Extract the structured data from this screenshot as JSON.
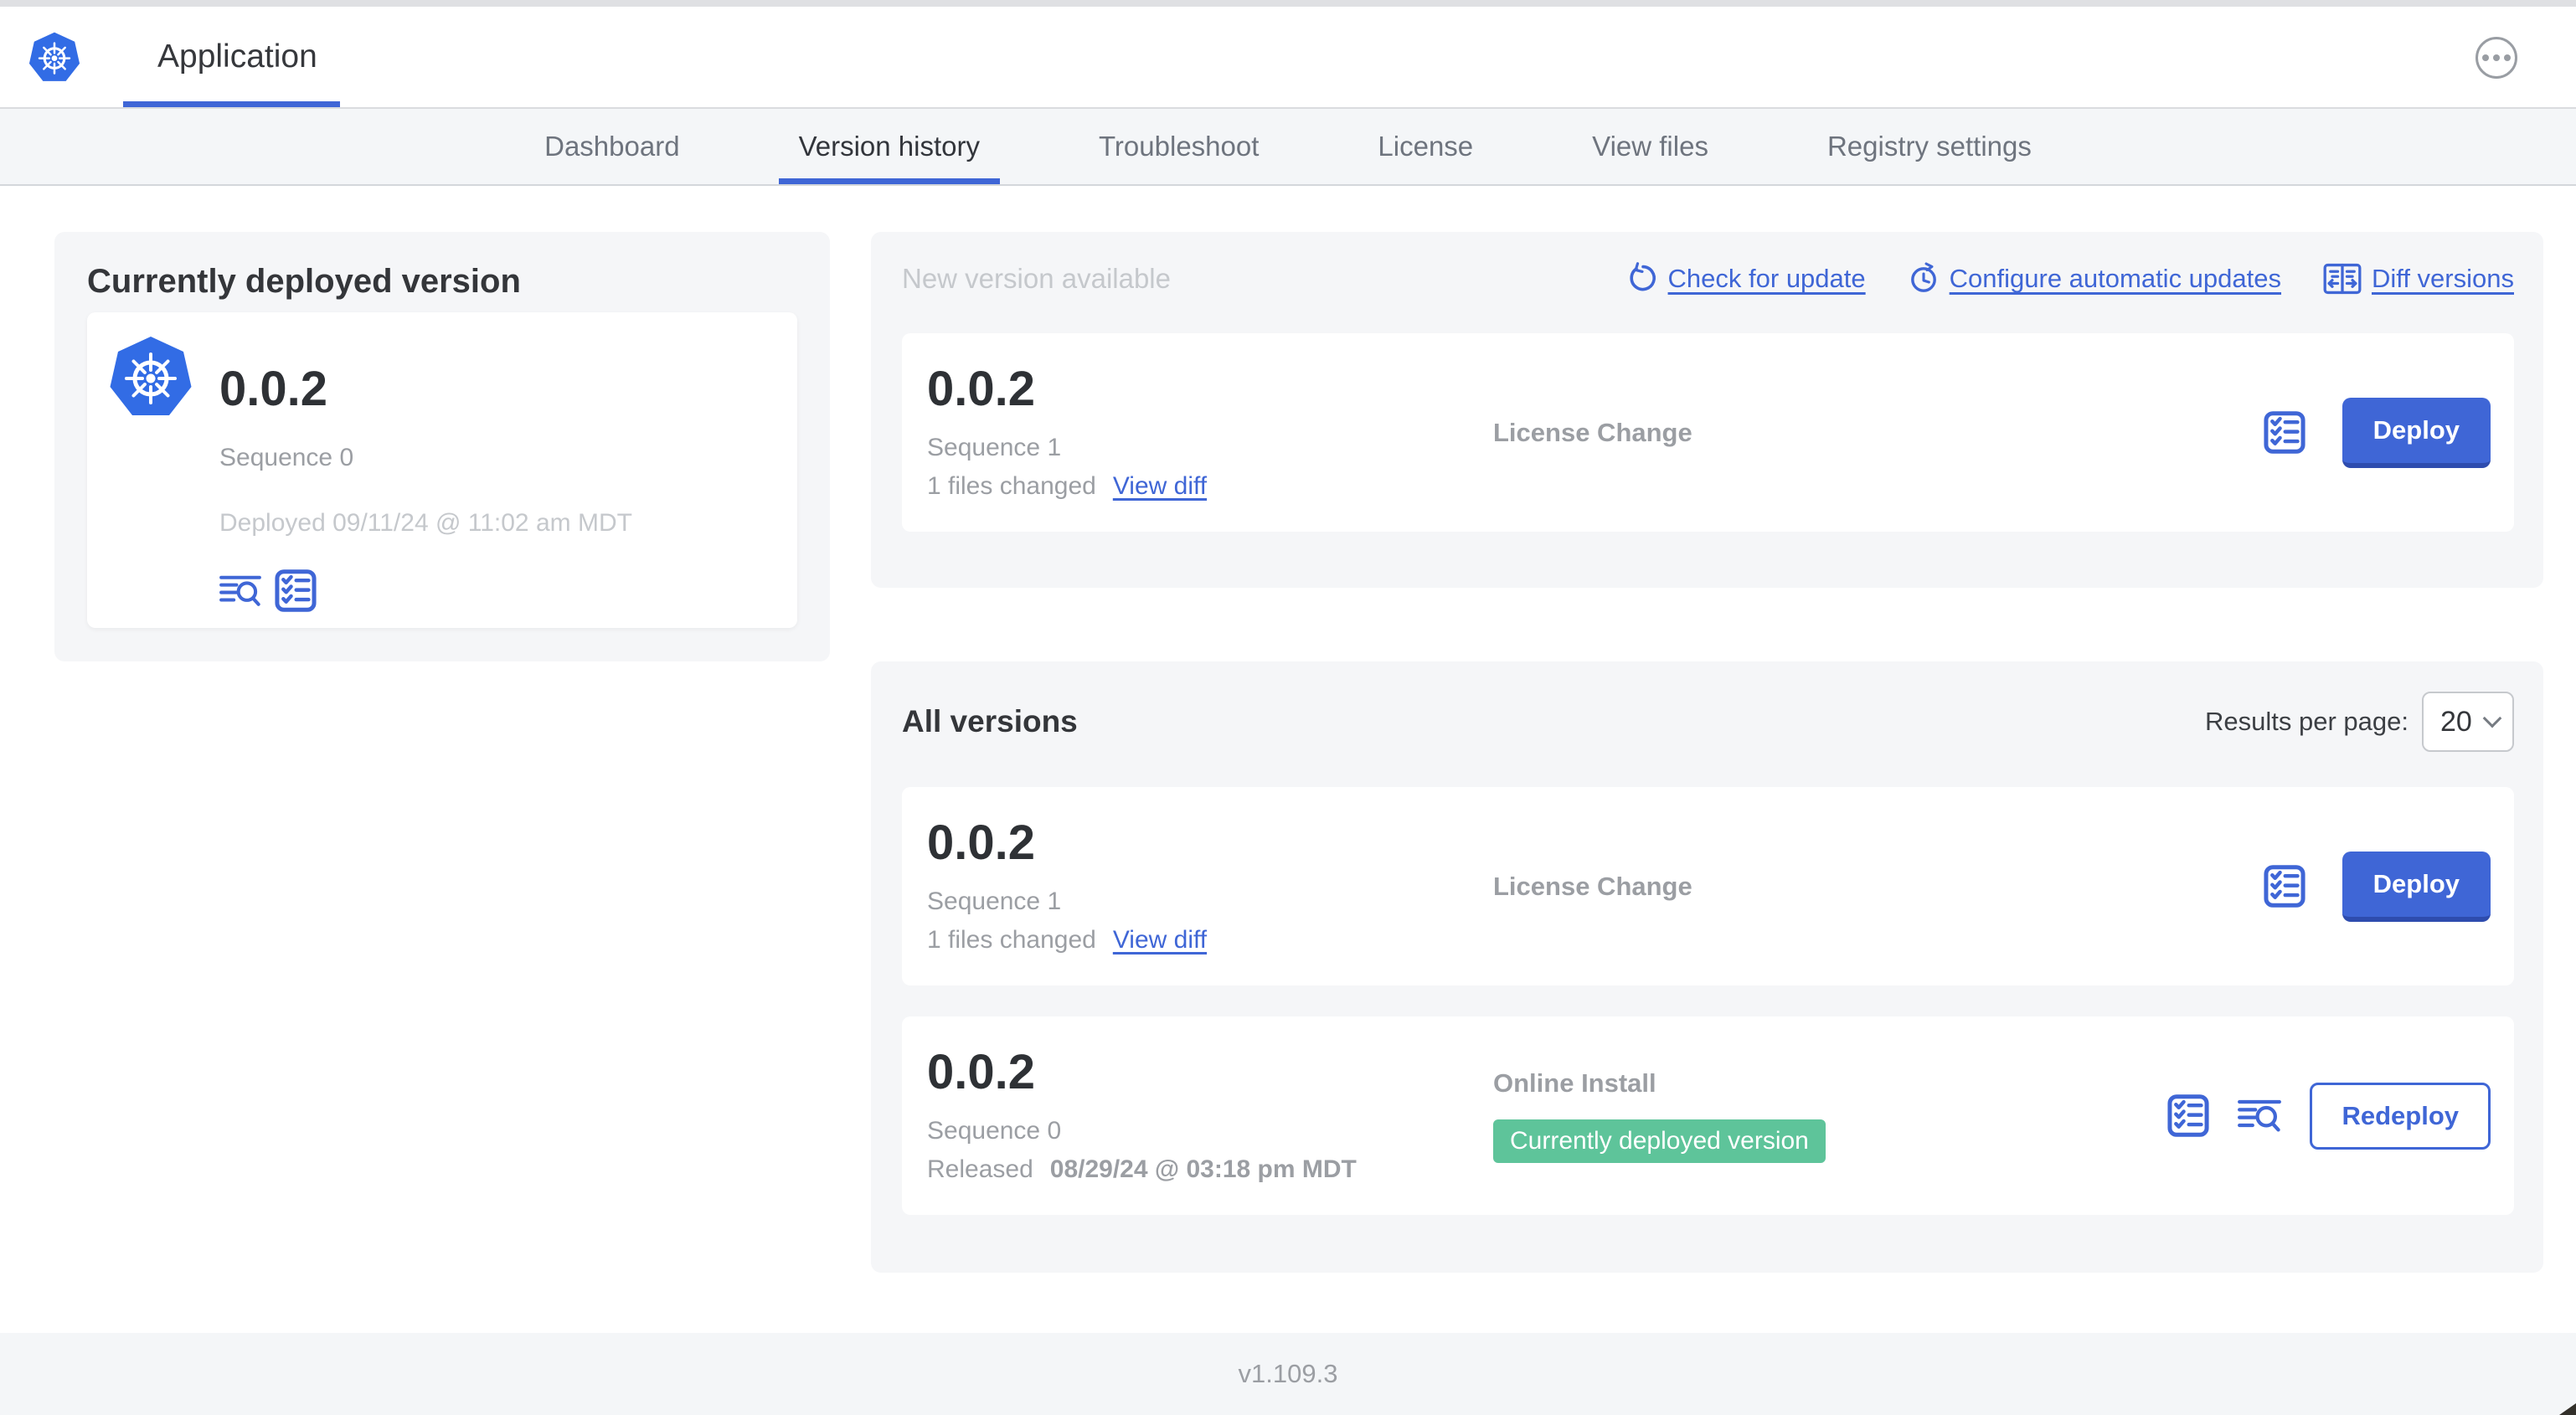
{
  "header": {
    "app_title": "Application"
  },
  "nav": {
    "active_tab": "Version history",
    "tabs": [
      {
        "label": "Dashboard"
      },
      {
        "label": "Version history"
      },
      {
        "label": "Troubleshoot"
      },
      {
        "label": "License"
      },
      {
        "label": "View files"
      },
      {
        "label": "Registry settings"
      }
    ]
  },
  "currently_deployed": {
    "title": "Currently deployed version",
    "version": "0.0.2",
    "sequence": "Sequence 0",
    "deployed": "Deployed 09/11/24 @ 11:02 am MDT"
  },
  "new_version": {
    "title": "New version available",
    "check_for_update": "Check for update",
    "configure_updates": "Configure automatic updates",
    "diff_versions": "Diff versions",
    "row": {
      "version": "0.0.2",
      "sequence": "Sequence 1",
      "files_changed": "1 files changed",
      "view_diff": "View diff",
      "source": "License Change",
      "action": "Deploy"
    }
  },
  "all_versions": {
    "title": "All versions",
    "results_label": "Results per page:",
    "results_value": "20",
    "rows": [
      {
        "version": "0.0.2",
        "sequence": "Sequence 1",
        "files_changed": "1 files changed",
        "view_diff": "View diff",
        "source": "License Change",
        "action": "Deploy"
      },
      {
        "version": "0.0.2",
        "sequence": "Sequence 0",
        "released_label": "Released",
        "released_date": "08/29/24 @ 03:18 pm MDT",
        "source": "Online Install",
        "badge": "Currently deployed version",
        "action": "Redeploy"
      }
    ]
  },
  "footer": {
    "version": "v1.109.3"
  },
  "colors": {
    "accent_blue": "#3f66d6",
    "accent_blue_dark": "#2e4cae",
    "k8s_blue": "#326ce5",
    "badge_green": "#5ec49a",
    "nav_bg": "#f4f6f8",
    "card_bg": "#f5f6f8"
  }
}
